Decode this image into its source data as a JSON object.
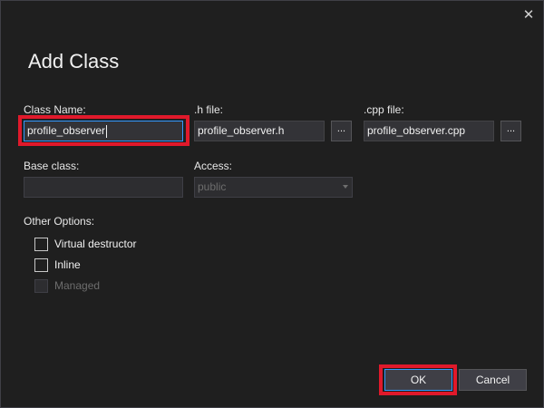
{
  "dialog": {
    "title": "Add Class",
    "close_glyph": "✕"
  },
  "fields": {
    "class_name": {
      "label": "Class Name:",
      "value": "profile_observer"
    },
    "h_file": {
      "label": ".h file:",
      "value": "profile_observer.h",
      "browse_label": "..."
    },
    "cpp_file": {
      "label": ".cpp file:",
      "value": "profile_observer.cpp",
      "browse_label": "..."
    },
    "base_class": {
      "label": "Base class:",
      "value": ""
    },
    "access": {
      "label": "Access:",
      "value": "public"
    }
  },
  "options": {
    "label": "Other Options:",
    "items": [
      {
        "label": "Virtual destructor",
        "checked": false,
        "enabled": true
      },
      {
        "label": "Inline",
        "checked": false,
        "enabled": true
      },
      {
        "label": "Managed",
        "checked": false,
        "enabled": false
      }
    ]
  },
  "buttons": {
    "ok_label": "OK",
    "cancel_label": "Cancel"
  },
  "colors": {
    "background": "#1f1f1f",
    "accent": "#3399ff",
    "highlight": "#e0192b"
  },
  "icons": {
    "close": "close-icon",
    "dropdown": "chevron-down-icon"
  }
}
